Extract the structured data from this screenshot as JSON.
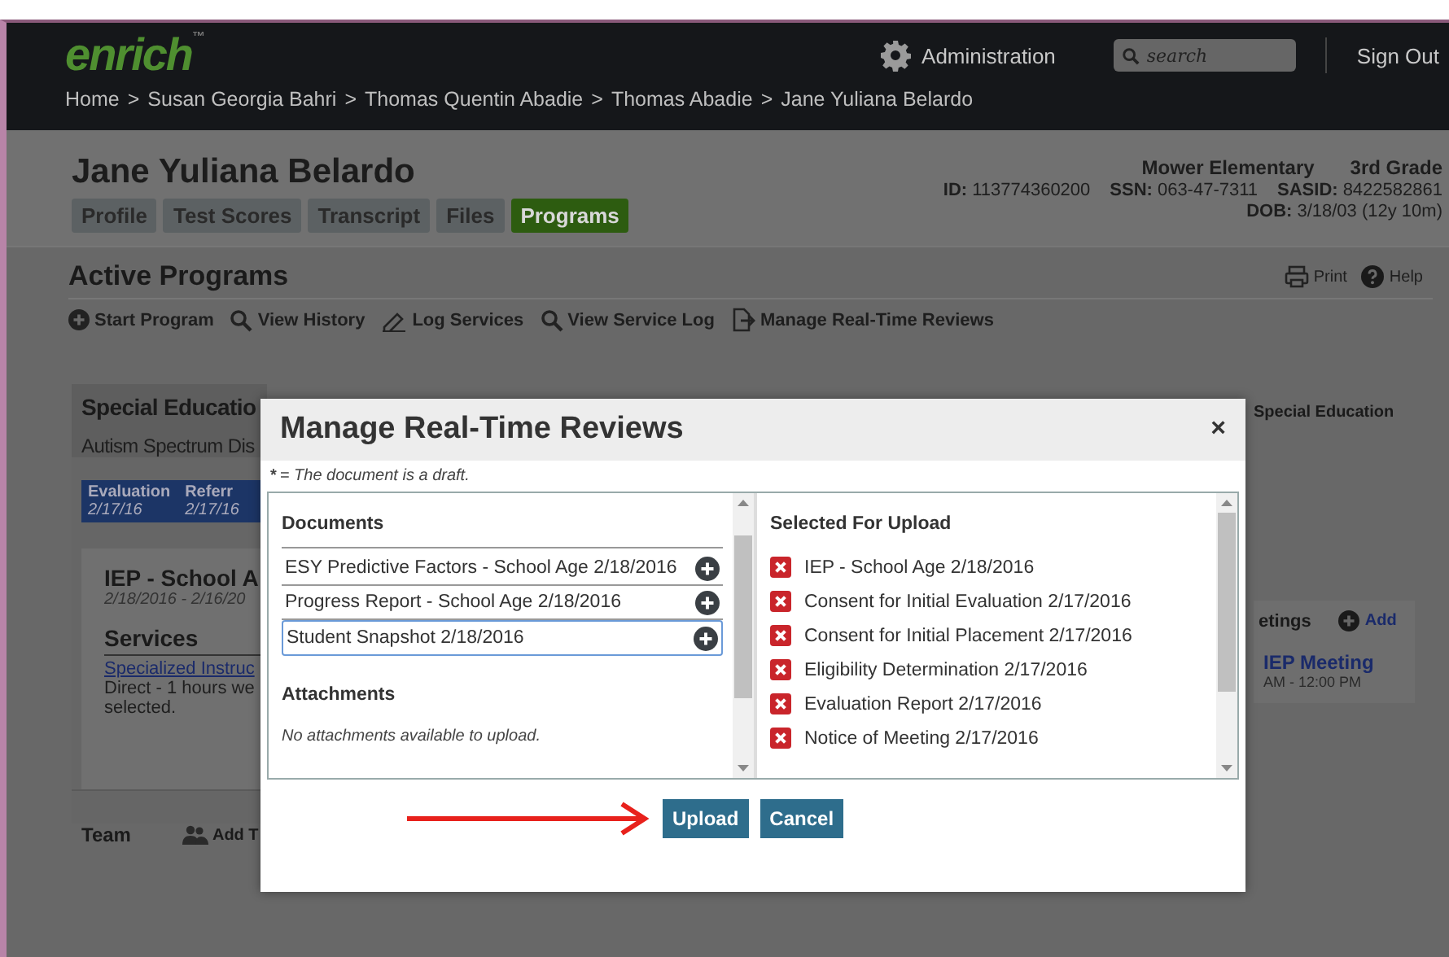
{
  "header": {
    "logo": "enrich",
    "logo_mark": "™",
    "admin": "Administration",
    "search": {
      "placeholder": "search"
    },
    "sign_out": "Sign Out",
    "breadcrumb_separator": ">",
    "breadcrumb": [
      "Home",
      "Susan Georgia Bahri",
      "Thomas Quentin Abadie",
      "Thomas Abadie",
      "Jane Yuliana Belardo"
    ]
  },
  "student": {
    "name": "Jane Yuliana Belardo",
    "tabs": [
      {
        "label": "Profile",
        "selected": false
      },
      {
        "label": "Test Scores",
        "selected": false
      },
      {
        "label": "Transcript",
        "selected": false
      },
      {
        "label": "Files",
        "selected": false
      },
      {
        "label": "Programs",
        "selected": true
      }
    ],
    "school": "Mower Elementary",
    "grade": "3rd Grade",
    "fields": [
      {
        "label": "ID:",
        "value": "113774360200"
      },
      {
        "label": "SSN:",
        "value": "063-47-7311"
      },
      {
        "label": "SASID:",
        "value": "8422582861"
      },
      {
        "label": "DOB:",
        "value": "3/18/03 (12y 10m)"
      }
    ]
  },
  "programs": {
    "title": "Active Programs",
    "print": "Print",
    "help": "Help",
    "actions": [
      {
        "label": "Start Program",
        "kind": "plus"
      },
      {
        "label": "View History",
        "kind": "search"
      },
      {
        "label": "Log Services",
        "kind": "pencil"
      },
      {
        "label": "View Service Log",
        "kind": "search"
      },
      {
        "label": "Manage Real-Time Reviews",
        "kind": "export"
      }
    ]
  },
  "program_card": {
    "title": "Special Educatio",
    "subtitle": "Autism Spectrum Dis",
    "steps": [
      {
        "label": "Evaluation",
        "date": "2/17/16"
      },
      {
        "label": "Referr",
        "date": "2/17/16"
      }
    ],
    "plan_title": "IEP - School A",
    "plan_dates": "2/18/2016 - 2/16/20",
    "services_heading": "Services",
    "service_link": "Specialized Instruc",
    "service_lines": [
      "Direct - 1 hours we",
      "selected."
    ],
    "team": "Team",
    "add_team": "Add T",
    "right_action": "Special Education",
    "meetings_heading": "etings",
    "meetings_add": "Add",
    "meeting": "IEP Meeting",
    "meeting_time": "AM - 12:00 PM"
  },
  "modal": {
    "title": "Manage Real-Time Reviews",
    "close": "×",
    "note_mark": "*",
    "note": "= The document is a draft.",
    "documents_heading": "Documents",
    "documents": [
      {
        "name": "ESY Predictive Factors - School Age 2/18/2016",
        "focused": false
      },
      {
        "name": "Progress Report - School Age 2/18/2016",
        "focused": false
      },
      {
        "name": "Student Snapshot 2/18/2016",
        "focused": true
      }
    ],
    "attachments_heading": "Attachments",
    "attachments_empty": "No attachments available to upload.",
    "selected_heading": "Selected For Upload",
    "selected": [
      "IEP - School Age 2/18/2016",
      "Consent for Initial Evaluation 2/17/2016",
      "Consent for Initial Placement 2/17/2016",
      "Eligibility Determination 2/17/2016",
      "Evaluation Report 2/17/2016",
      "Notice of Meeting 2/17/2016"
    ],
    "buttons": [
      {
        "label": "Upload"
      },
      {
        "label": "Cancel"
      }
    ]
  }
}
